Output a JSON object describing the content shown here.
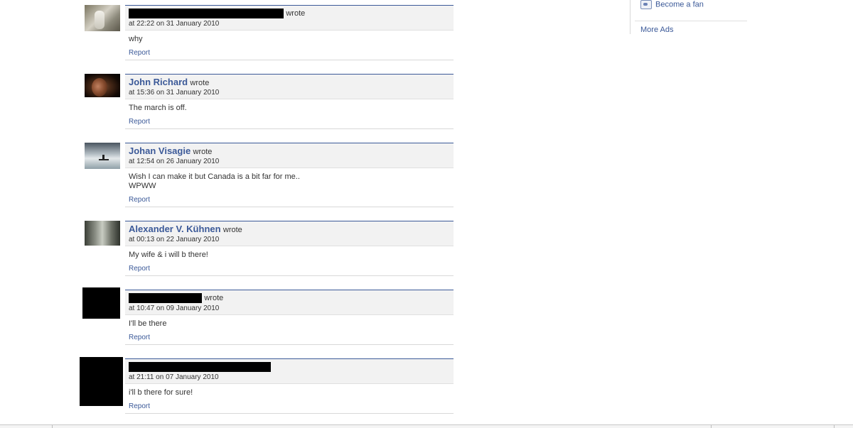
{
  "posts": [
    {
      "author": "",
      "wrote": "wrote",
      "time": "at 22:22 on 31 January 2010",
      "message": "why",
      "report": "Report",
      "avatar": "photo-person-light"
    },
    {
      "author": "John Richard",
      "wrote": "wrote",
      "time": "at 15:36 on 31 January 2010",
      "message": "The march is off.",
      "report": "Report",
      "avatar": "photo-face-dark"
    },
    {
      "author": "Johan Visagie",
      "wrote": "wrote",
      "time": "at 12:54 on 26 January 2010",
      "message": "Wish I can make it but Canada is a bit far for me..\nWPWW",
      "report": "Report",
      "avatar": "photo-lake-canoe"
    },
    {
      "author": "Alexander V. Kühnen",
      "wrote": "wrote",
      "time": "at 00:13 on 22 January 2010",
      "message": "My wife & i will b there!",
      "report": "Report",
      "avatar": "photo-grey-figures"
    },
    {
      "author": "",
      "wrote": "wrote",
      "time": "at 10:47 on 09 January 2010",
      "message": "I'll be there",
      "report": "Report",
      "avatar": "redacted"
    },
    {
      "author": "",
      "wrote": "",
      "time": "at 21:11 on 07 January 2010",
      "message": "i'll b there for sure!",
      "report": "Report",
      "avatar": "redacted"
    }
  ],
  "sidebar": {
    "become_fan": "Become a fan",
    "become_fan_icon": "fan-page-icon",
    "more_ads": "More Ads"
  },
  "colors": {
    "link": "#3b5998",
    "header_bg": "#f2f2f2",
    "header_border": "#3b5998"
  }
}
